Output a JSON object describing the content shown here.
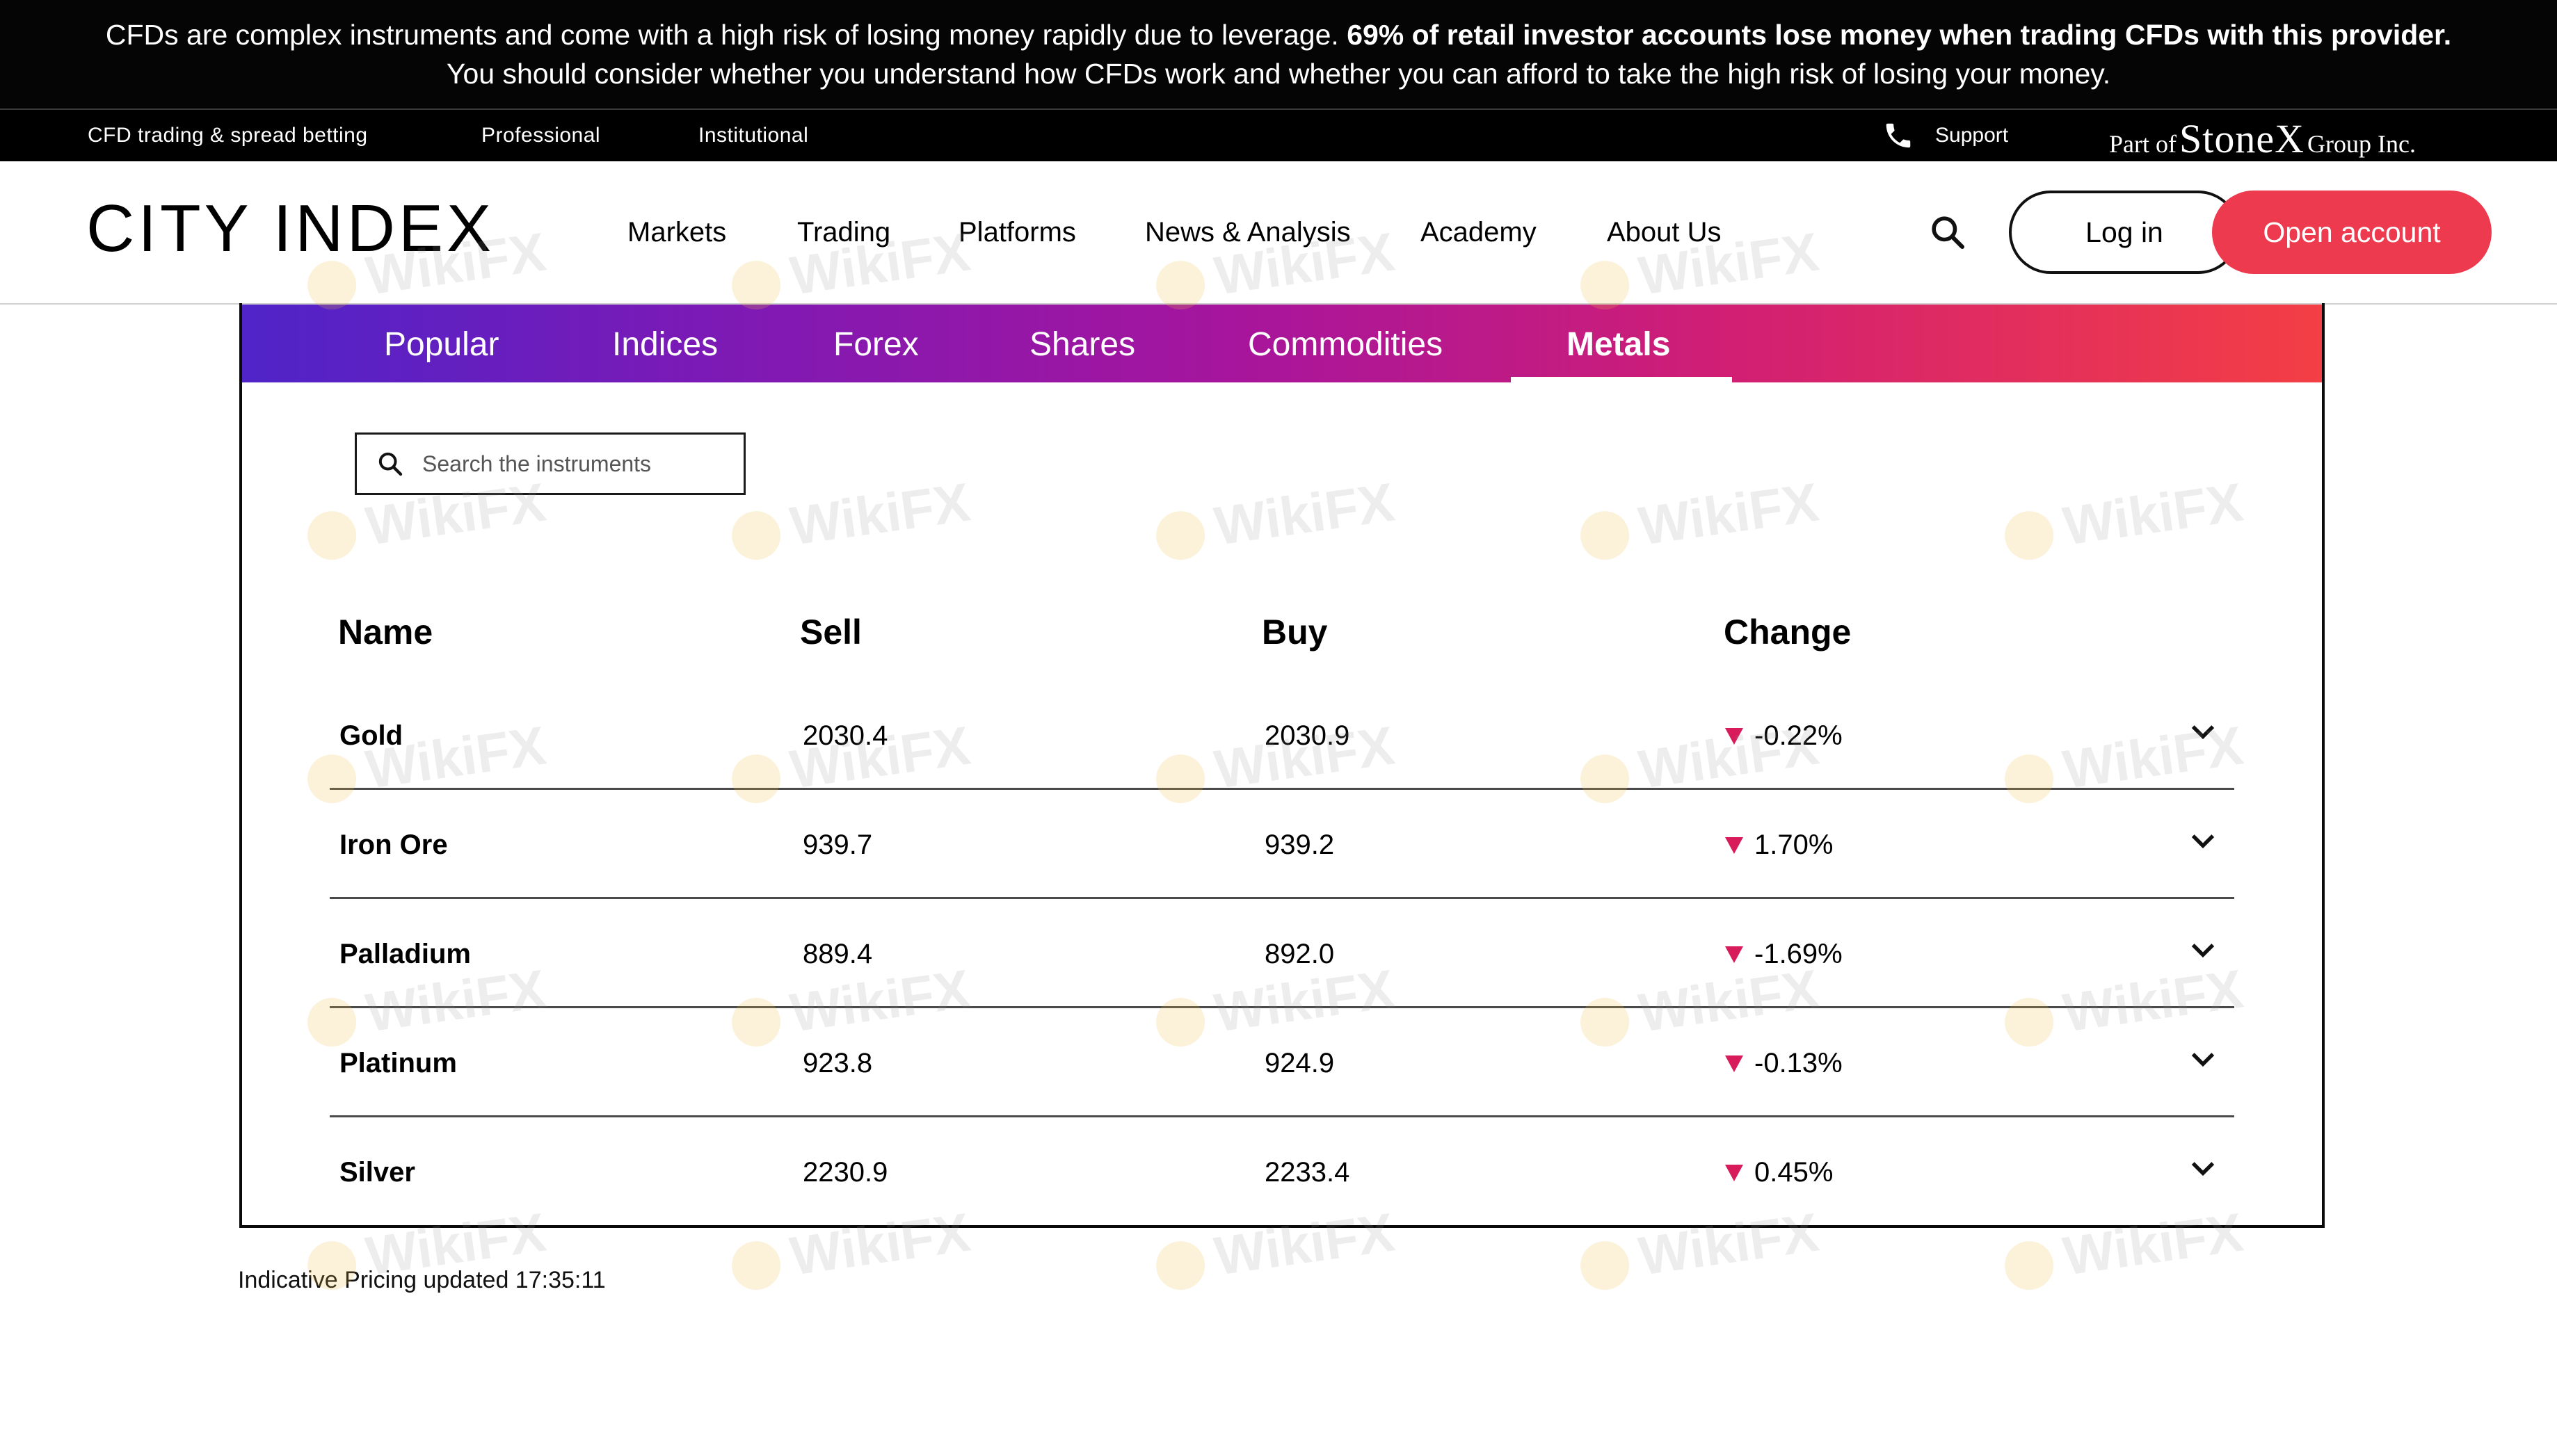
{
  "risk_warning": {
    "pre": "CFDs are complex instruments and come with a high risk of losing money rapidly due to leverage. ",
    "bold": "69% of retail investor accounts lose money when trading CFDs with this provider.",
    "post": " You should consider whether you understand how CFDs work and whether you can afford to take the high risk of losing your money."
  },
  "subnav": {
    "links": [
      "CFD trading & spread betting",
      "Professional",
      "Institutional"
    ],
    "support": "Support",
    "group_pre": "Part of",
    "group_brand": "StoneX",
    "group_post": "Group Inc."
  },
  "header": {
    "logo": "CITY INDEX",
    "nav": [
      "Markets",
      "Trading",
      "Platforms",
      "News & Analysis",
      "Academy",
      "About Us"
    ],
    "login": "Log in",
    "open_account": "Open account"
  },
  "tabs": {
    "items": [
      "Popular",
      "Indices",
      "Forex",
      "Shares",
      "Commodities",
      "Metals"
    ],
    "active": "Metals"
  },
  "search": {
    "placeholder": "Search the instruments"
  },
  "table": {
    "headers": [
      "Name",
      "Sell",
      "Buy",
      "Change"
    ],
    "rows": [
      {
        "name": "Gold",
        "sell": "2030.4",
        "buy": "2030.9",
        "change": "-0.22%"
      },
      {
        "name": "Iron Ore",
        "sell": "939.7",
        "buy": "939.2",
        "change": "1.70%"
      },
      {
        "name": "Palladium",
        "sell": "889.4",
        "buy": "892.0",
        "change": "-1.69%"
      },
      {
        "name": "Platinum",
        "sell": "923.8",
        "buy": "924.9",
        "change": "-0.13%"
      },
      {
        "name": "Silver",
        "sell": "2230.9",
        "buy": "2233.4",
        "change": "0.45%"
      }
    ]
  },
  "updated": "Indicative Pricing updated 17:35:11",
  "watermark": "WikiFX",
  "colors": {
    "accent": "#ee3a4e",
    "down_arrow": "#d81b5b",
    "gradient_start": "#4f24c8",
    "gradient_end": "#f43f44"
  }
}
